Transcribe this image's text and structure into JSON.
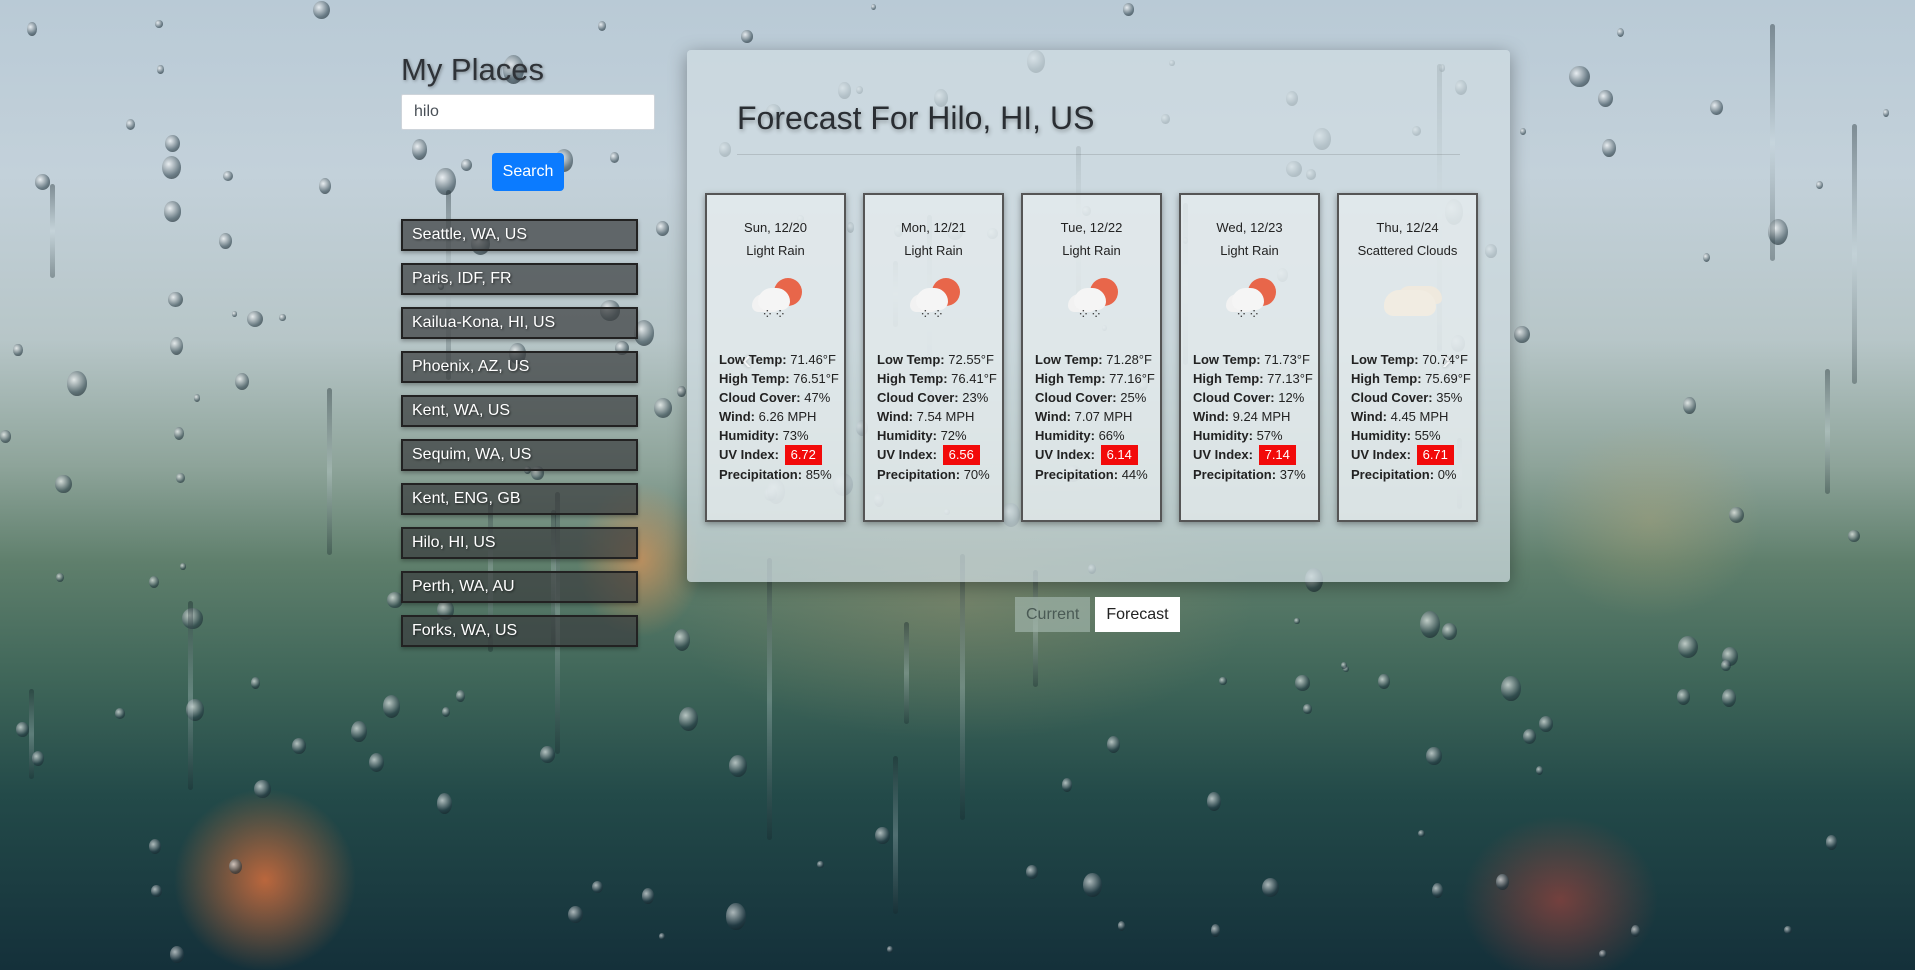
{
  "sidebar": {
    "title": "My Places",
    "search_value": "hilo",
    "search_button": "Search",
    "places": [
      "Seattle, WA, US",
      "Paris, IDF, FR",
      "Kailua-Kona, HI, US",
      "Phoenix, AZ, US",
      "Kent, WA, US",
      "Sequim, WA, US",
      "Kent, ENG, GB",
      "Hilo, HI, US",
      "Perth, WA, AU",
      "Forks, WA, US"
    ]
  },
  "forecast": {
    "title": "Forecast For Hilo, HI, US",
    "labels": {
      "low": "Low Temp:",
      "high": "High Temp:",
      "cloud": "Cloud Cover:",
      "wind": "Wind:",
      "humidity": "Humidity:",
      "uv": "UV Index:",
      "precip": "Precipitation:"
    },
    "days": [
      {
        "date": "Sun, 12/20",
        "condition": "Light Rain",
        "icon": "light-rain-icon",
        "low": "71.46°F",
        "high": "76.51°F",
        "cloud": "47%",
        "wind": "6.26 MPH",
        "humidity": "73%",
        "uv": "6.72",
        "precip": "85%"
      },
      {
        "date": "Mon, 12/21",
        "condition": "Light Rain",
        "icon": "light-rain-icon",
        "low": "72.55°F",
        "high": "76.41°F",
        "cloud": "23%",
        "wind": "7.54 MPH",
        "humidity": "72%",
        "uv": "6.56",
        "precip": "70%"
      },
      {
        "date": "Tue, 12/22",
        "condition": "Light Rain",
        "icon": "light-rain-icon",
        "low": "71.28°F",
        "high": "77.16°F",
        "cloud": "25%",
        "wind": "7.07 MPH",
        "humidity": "66%",
        "uv": "6.14",
        "precip": "44%"
      },
      {
        "date": "Wed, 12/23",
        "condition": "Light Rain",
        "icon": "light-rain-icon",
        "low": "71.73°F",
        "high": "77.13°F",
        "cloud": "12%",
        "wind": "9.24 MPH",
        "humidity": "57%",
        "uv": "7.14",
        "precip": "37%"
      },
      {
        "date": "Thu, 12/24",
        "condition": "Scattered Clouds",
        "icon": "scattered-clouds-icon",
        "low": "70.74°F",
        "high": "75.69°F",
        "cloud": "35%",
        "wind": "4.45 MPH",
        "humidity": "55%",
        "uv": "6.71",
        "precip": "0%"
      }
    ],
    "prev_arrow": "‹",
    "next_arrow": "›"
  },
  "view_toggle": {
    "current": "Current",
    "forecast": "Forecast",
    "active": "Forecast"
  },
  "colors": {
    "search_button": "#0b7bff",
    "uv_badge": "#f20a0a"
  }
}
